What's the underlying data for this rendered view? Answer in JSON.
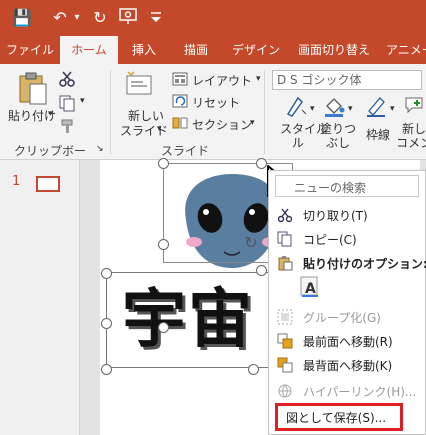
{
  "ribbon_tabs": [
    "ファイル",
    "ホーム",
    "挿入",
    "描画",
    "デザイン",
    "画面切り替え",
    "アニメー"
  ],
  "active_tab": "ホーム",
  "ribbon": {
    "paste": "貼り付け",
    "clipboard_group": "クリップボード",
    "new_slide_1": "新しい",
    "new_slide_2": "スライド",
    "layout": "レイアウト",
    "reset": "リセット",
    "section": "セクション",
    "slides_group": "スライド",
    "font_box": "D S ゴシック体",
    "style_1": "スタイル",
    "style_2": "ル",
    "fill_1": "塗りつ",
    "fill_2": "ぶし",
    "outline": "枠線",
    "new_comment_1": "新し",
    "new_comment_2": "コメン"
  },
  "thumbnail_number": "1",
  "slide_text": "宇宙",
  "context_menu": {
    "search": "ニューの検索",
    "items": [
      {
        "label": "切り取り(T)",
        "disabled": false
      },
      {
        "label": "コピー(C)",
        "disabled": false
      },
      {
        "label": "貼り付けのオプション:",
        "disabled": false
      },
      {
        "label": "グループ化(G)",
        "disabled": true
      },
      {
        "label": "最前面へ移動(R)",
        "disabled": false
      },
      {
        "label": "最背面へ移動(K)",
        "disabled": false
      },
      {
        "label": "ハイパーリンク(H)...",
        "disabled": true
      },
      {
        "label": "図として保存(S)...",
        "disabled": false
      }
    ]
  },
  "colors": {
    "accent": "#c4492b",
    "highlight_box": "#e02020",
    "alien": "#5a7ea0"
  }
}
